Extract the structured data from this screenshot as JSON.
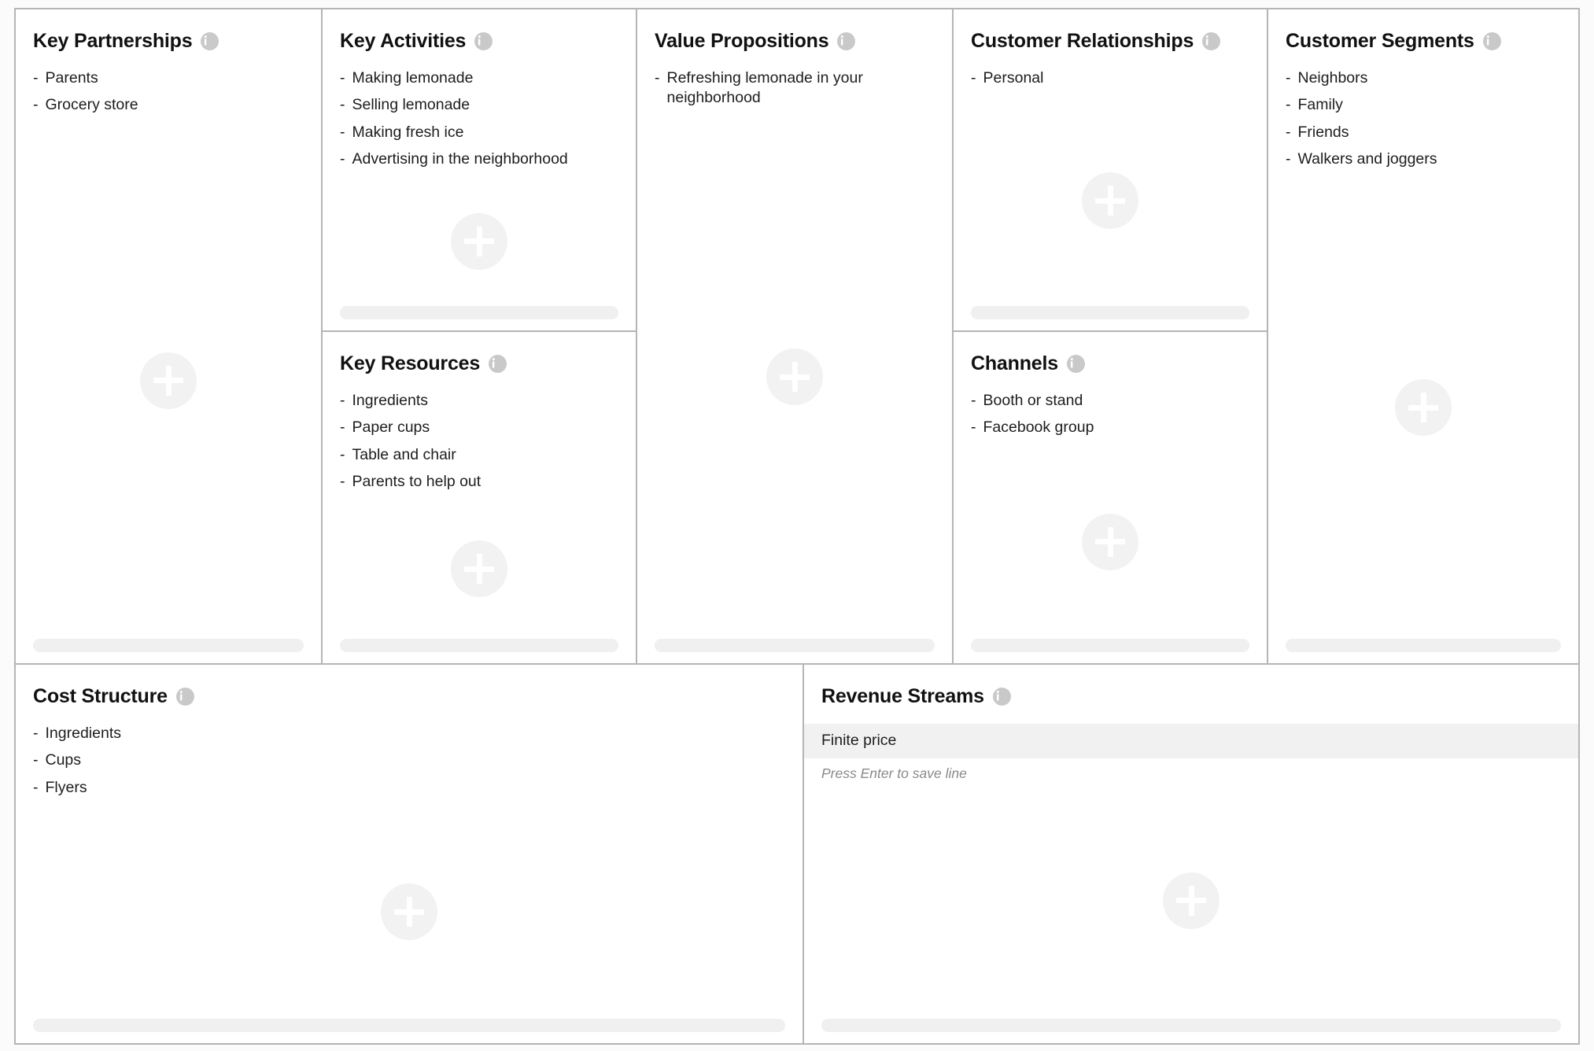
{
  "theme": {
    "page_background": "#fbfbfb",
    "panel_background": "#ffffff",
    "border": "#b5b5b5",
    "text": "#1d1d1d",
    "title": "#111111",
    "info_icon": "#c9c9c9",
    "add_button": "#f2f2f2",
    "scrollbar": "#f0f0f0",
    "edit_row_highlight": "#f1f1f1",
    "hint_text": "#8a8a8a"
  },
  "icons": {
    "info": "info-icon",
    "add": "plus-icon",
    "scrollbar": "horizontal-scrollbar"
  },
  "blocks": {
    "key_partnerships": {
      "title": "Key Partnerships",
      "items": [
        "Parents",
        "Grocery store"
      ]
    },
    "key_activities": {
      "title": "Key Activities",
      "items": [
        "Making lemonade",
        "Selling lemonade",
        "Making fresh ice",
        "Advertising in the neighborhood"
      ]
    },
    "key_resources": {
      "title": "Key Resources",
      "items": [
        "Ingredients",
        "Paper cups",
        "Table and chair",
        "Parents to help out"
      ]
    },
    "value_propositions": {
      "title": "Value Propositions",
      "items": [
        "Refreshing lemonade in your neighborhood"
      ]
    },
    "customer_relationships": {
      "title": "Customer Relationships",
      "items": [
        "Personal"
      ]
    },
    "channels": {
      "title": "Channels",
      "items": [
        "Booth or stand",
        "Facebook group"
      ]
    },
    "customer_segments": {
      "title": "Customer Segments",
      "items": [
        "Neighbors",
        "Family",
        "Friends",
        "Walkers and joggers"
      ]
    },
    "cost_structure": {
      "title": "Cost Structure",
      "items": [
        "Ingredients",
        "Cups",
        "Flyers"
      ]
    },
    "revenue_streams": {
      "title": "Revenue Streams",
      "items": [],
      "editing_value": "Finite price",
      "editing_hint": "Press Enter to save line"
    }
  },
  "bullet": "-"
}
